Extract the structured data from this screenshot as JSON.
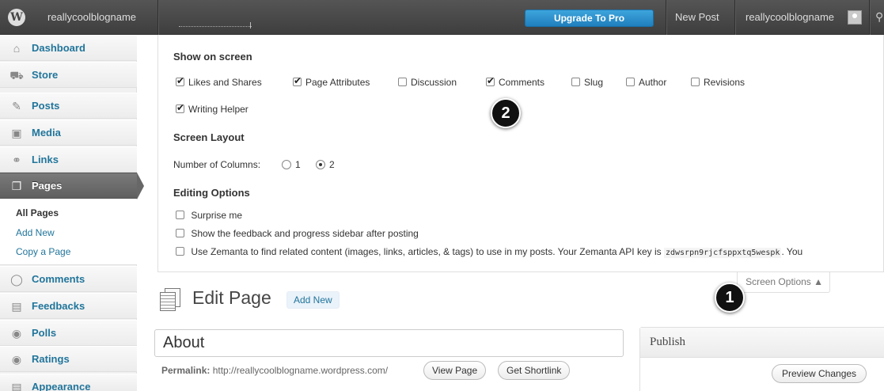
{
  "adminbar": {
    "site_name": "reallycoolblogname",
    "upgrade_label": "Upgrade To Pro",
    "new_post_label": "New Post",
    "account_name": "reallycoolblogname",
    "logo_glyph": "W"
  },
  "sidebar": {
    "items": [
      {
        "label": "Dashboard",
        "icon": "house-icon",
        "glyph": "⌂"
      },
      {
        "label": "Store",
        "icon": "cart-icon",
        "glyph": "⛟"
      },
      {
        "label": "Posts",
        "icon": "pushpin-icon",
        "glyph": "✎"
      },
      {
        "label": "Media",
        "icon": "media-icon",
        "glyph": "▣"
      },
      {
        "label": "Links",
        "icon": "link-icon",
        "glyph": "⚭"
      },
      {
        "label": "Pages",
        "icon": "pages-icon",
        "glyph": "❐"
      },
      {
        "label": "Comments",
        "icon": "speech-bubble-icon",
        "glyph": "◯"
      },
      {
        "label": "Feedbacks",
        "icon": "feedback-icon",
        "glyph": "▤"
      },
      {
        "label": "Polls",
        "icon": "poll-icon",
        "glyph": "◉"
      },
      {
        "label": "Ratings",
        "icon": "rating-icon",
        "glyph": "◉"
      },
      {
        "label": "Appearance",
        "icon": "appearance-icon",
        "glyph": "▤"
      }
    ],
    "submenu": [
      "All Pages",
      "Add New",
      "Copy a Page"
    ]
  },
  "screen_options": {
    "show_heading": "Show on screen",
    "checkboxes": [
      {
        "label": "Likes and Shares",
        "checked": true
      },
      {
        "label": "Page Attributes",
        "checked": true
      },
      {
        "label": "Discussion",
        "checked": false
      },
      {
        "label": "Comments",
        "checked": true
      },
      {
        "label": "Slug",
        "checked": false
      },
      {
        "label": "Author",
        "checked": false
      },
      {
        "label": "Revisions",
        "checked": false
      },
      {
        "label": "Writing Helper",
        "checked": true
      }
    ],
    "layout_heading": "Screen Layout",
    "columns_label": "Number of Columns:",
    "column_options": [
      "1",
      "2"
    ],
    "columns_selected": "2",
    "editing_heading": "Editing Options",
    "editing_options": [
      "Surprise me",
      "Show the feedback and progress sidebar after posting",
      "Use Zemanta to find related content (images, links, articles, & tags) to use in my posts. Your Zemanta API key is"
    ],
    "api_key": "zdwsrpn9rjcfsppxtq5wespk",
    "api_tail": ". You",
    "tab_label": "Screen Options ▲"
  },
  "content": {
    "page_title": "Edit Page",
    "add_new_label": "Add New",
    "title_value": "About",
    "permalink_label": "Permalink:",
    "permalink_url": "http://reallycoolblogname.wordpress.com/",
    "view_page_label": "View Page",
    "shortlink_label": "Get Shortlink",
    "publish_title": "Publish",
    "preview_label": "Preview Changes"
  },
  "callouts": [
    "1",
    "2"
  ]
}
